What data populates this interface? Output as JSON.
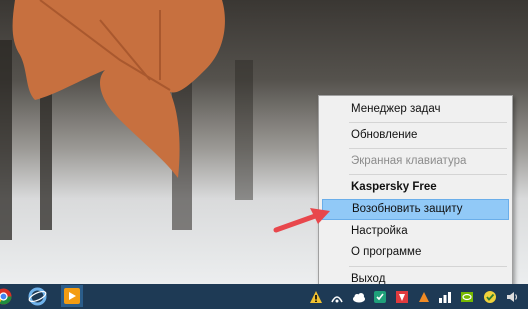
{
  "context_menu": {
    "items": [
      {
        "label": "Менеджер задач",
        "state": "normal"
      },
      {
        "label": "Обновление",
        "state": "normal"
      },
      {
        "label": "Экранная клавиатура",
        "state": "disabled"
      },
      {
        "label": "Kaspersky Free",
        "state": "bold"
      },
      {
        "label": "Возобновить защиту",
        "state": "highlighted"
      },
      {
        "label": "Настройка",
        "state": "normal"
      },
      {
        "label": "О программе",
        "state": "normal"
      },
      {
        "label": "Выход",
        "state": "normal"
      }
    ]
  },
  "taskbar": {
    "apps": [
      "chrome-icon",
      "browser-icon",
      "media-player-icon"
    ],
    "tray_icons": [
      "warning-icon",
      "connection-icon",
      "cloud-icon",
      "shield-icon",
      "network-icon",
      "kaspersky-icon",
      "app-icon",
      "nvidia-icon",
      "volume-icon",
      "update-icon",
      "language-icon"
    ]
  },
  "colors": {
    "taskbar": "#1e3a55",
    "menu_background": "#f0f0f0",
    "highlight": "#91c9f7",
    "annotation_arrow": "#e8474c"
  }
}
